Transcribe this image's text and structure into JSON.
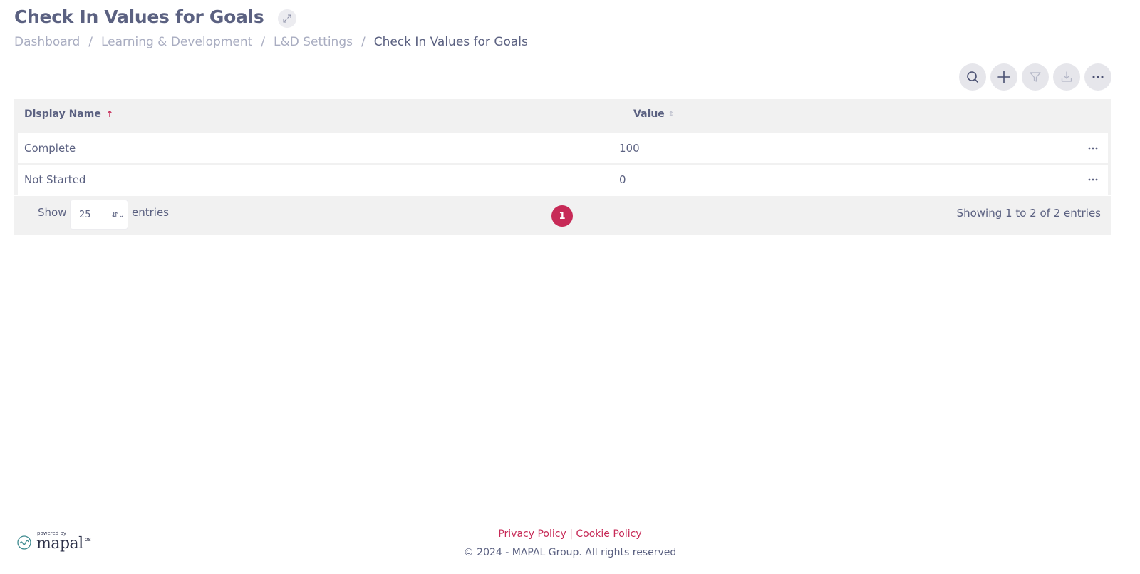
{
  "header": {
    "title": "Check In Values for Goals"
  },
  "breadcrumb": {
    "items": [
      "Dashboard",
      "Learning & Development",
      "L&D Settings"
    ],
    "current": "Check In Values for Goals",
    "separator": "/"
  },
  "toolbar": {
    "icons": [
      "search-icon",
      "plus-icon",
      "filter-icon",
      "download-icon",
      "more-icon"
    ]
  },
  "table": {
    "columns": [
      "Display Name",
      "Value"
    ],
    "sort": {
      "column": "Display Name",
      "direction": "ascending"
    },
    "rows": [
      {
        "name": "Complete",
        "value": "100"
      },
      {
        "name": "Not Started",
        "value": "0"
      }
    ],
    "show_label": "Show",
    "page_length": "25",
    "entries_label": "entries",
    "current_page": "1",
    "info": "Showing 1 to 2 of 2 entries"
  },
  "footer": {
    "powered_by": "powered by",
    "logo": "mapal",
    "logo_suffix": "os",
    "privacy": "Privacy Policy",
    "link_sep": "|",
    "cookie": "Cookie Policy",
    "copyright": "© 2024 - MAPAL Group. All rights reserved"
  },
  "colors": {
    "accent": "#c72a57",
    "text": "#5b6181",
    "muted": "#a9adc1",
    "table_bg": "#f1f1f1"
  }
}
